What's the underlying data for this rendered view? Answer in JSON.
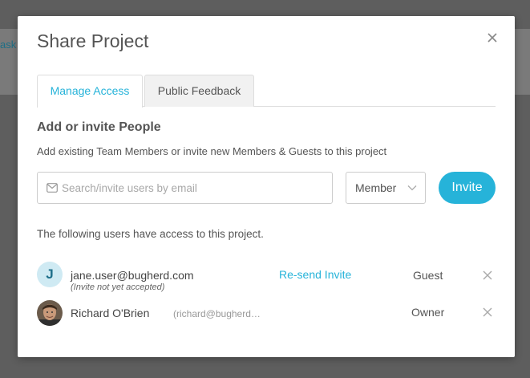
{
  "background": {
    "task_fragment": "ask"
  },
  "modal": {
    "title": "Share Project",
    "tabs": [
      {
        "label": "Manage Access",
        "active": true
      },
      {
        "label": "Public Feedback",
        "active": false
      }
    ]
  },
  "invite": {
    "section_title": "Add or invite People",
    "description": "Add existing Team Members or invite new Members & Guests to this project",
    "search_placeholder": "Search/invite users by email",
    "search_value": "",
    "role_selected": "Member",
    "invite_label": "Invite"
  },
  "access": {
    "note": "The following users have access to this project.",
    "users": [
      {
        "avatar_initial": "J",
        "email": "jane.user@bugherd.com",
        "status": "(Invite not yet accepted)",
        "action_label": "Re-send Invite",
        "role": "Guest"
      },
      {
        "name": "Richard O'Brien",
        "handle": "(richard@bugherd…",
        "role": "Owner"
      }
    ]
  },
  "colors": {
    "accent": "#26b3d9",
    "overlay": "#5e5e5e",
    "text": "#444444"
  }
}
